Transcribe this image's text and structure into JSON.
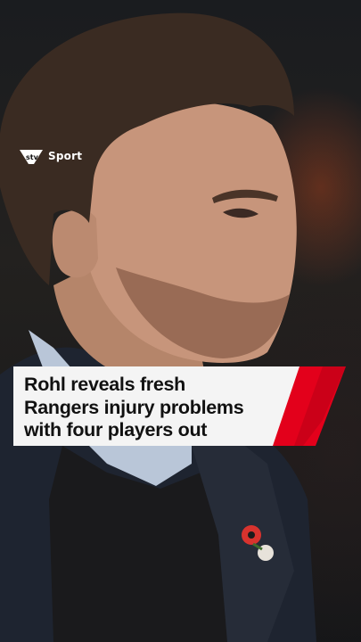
{
  "brand": {
    "logo_text": "Sport",
    "logo_mark": "stv",
    "accent_color": "#e3001b"
  },
  "headline": {
    "text": "Rohl reveals fresh\nRangers injury problems\nwith four players out"
  },
  "photo": {
    "subject": "man-in-dark-coat-portrait-icon",
    "pin": "poppy-pin-icon"
  }
}
